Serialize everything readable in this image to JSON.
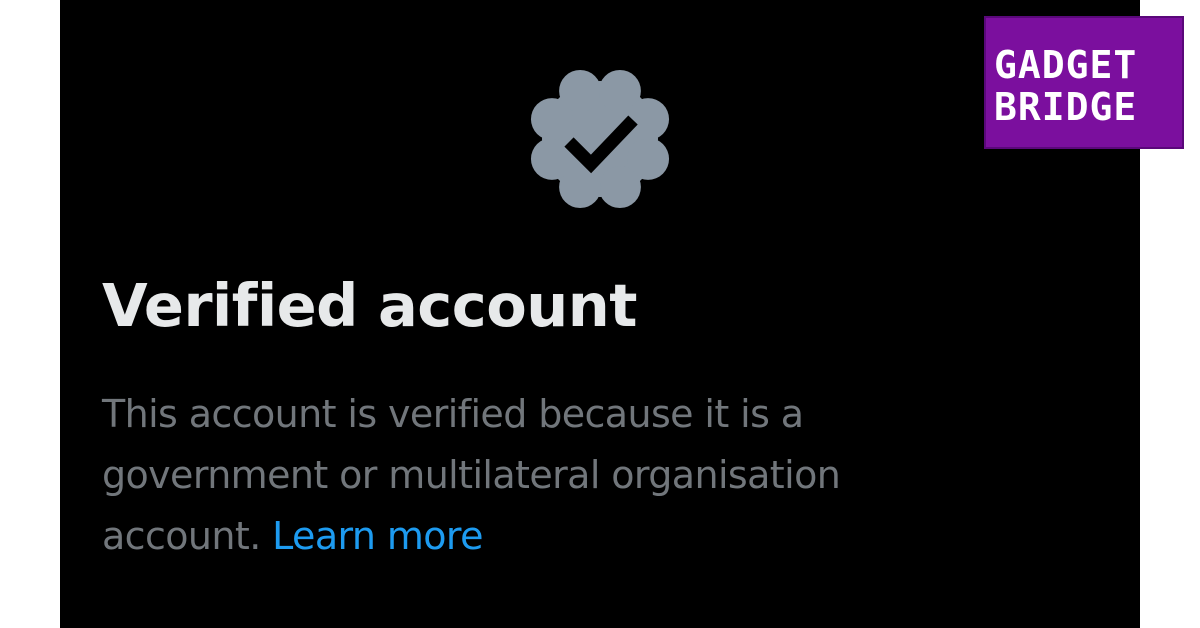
{
  "colors": {
    "page_background": "#ffffff",
    "panel_background": "#000000",
    "title_text": "#e7e9ea",
    "body_text": "#71767b",
    "link": "#1d9bf0",
    "badge_fill": "#8b98a5",
    "badge_check": "#000000",
    "logo_background": "#7b0f9e"
  },
  "badge": {
    "icon": "verified-badge-icon"
  },
  "dialog": {
    "title": "Verified account",
    "description_lines": [
      "This account is verified because it is a",
      "government or multilateral organisation",
      "account."
    ],
    "learn_more": "Learn more"
  },
  "watermark": {
    "line1": "GADGET",
    "line2": "BRIDGE"
  }
}
